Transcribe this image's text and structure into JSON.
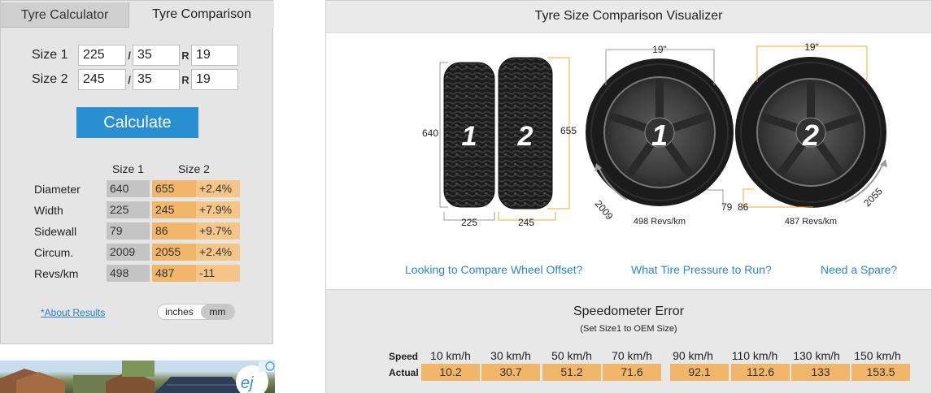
{
  "tabs": {
    "calculator": "Tyre Calculator",
    "comparison": "Tyre Comparison"
  },
  "form": {
    "size1": {
      "label": "Size 1",
      "width": "225",
      "aspect": "35",
      "rim": "19"
    },
    "size2": {
      "label": "Size 2",
      "width": "245",
      "aspect": "35",
      "rim": "19"
    },
    "sep": "/",
    "r": "R",
    "calculate_label": "Calculate"
  },
  "results": {
    "headers": [
      "Size 1",
      "Size 2"
    ],
    "rows": [
      {
        "label": "Diameter",
        "s1": "640",
        "s2": "655",
        "diff": "+2.4%"
      },
      {
        "label": "Width",
        "s1": "225",
        "s2": "245",
        "diff": "+7.9%"
      },
      {
        "label": "Sidewall",
        "s1": "79",
        "s2": "86",
        "diff": "+9.7%"
      },
      {
        "label": "Circum.",
        "s1": "2009",
        "s2": "2055",
        "diff": "+2.4%"
      },
      {
        "label": "Revs/km",
        "s1": "498",
        "s2": "487",
        "diff": "-11"
      }
    ]
  },
  "about_link": "*About Results",
  "units": {
    "inches": "inches",
    "mm": "mm",
    "selected": "mm"
  },
  "visualizer": {
    "title": "Tyre Size Comparison Visualizer",
    "tyre1_number": "1",
    "tyre2_number": "2",
    "diameter1": "640",
    "diameter2": "655",
    "width1": "225",
    "width2": "245",
    "rim1": "19\"",
    "rim2": "19\"",
    "sidewall1": "79",
    "sidewall2": "86",
    "circum1": "2009",
    "circum2": "2055",
    "revs1": "498 Revs/km",
    "revs2": "487 Revs/km",
    "colors": {
      "size1": "#9a9a9a",
      "size2": "#f0a830"
    }
  },
  "links": {
    "offset": "Looking to Compare Wheel Offset?",
    "pressure": "What Tire Pressure to Run?",
    "spare": "Need a Spare?"
  },
  "speedo": {
    "title": "Speedometer Error",
    "subtitle": "(Set Size1 to OEM Size)",
    "speed_label": "Speed",
    "actual_label": "Actual",
    "columns": [
      {
        "speed": "10 km/h",
        "actual": "10.2"
      },
      {
        "speed": "30 km/h",
        "actual": "30.7"
      },
      {
        "speed": "50 km/h",
        "actual": "51.2"
      },
      {
        "speed": "70 km/h",
        "actual": "71.6"
      },
      {
        "speed": "90 km/h",
        "actual": "92.1"
      },
      {
        "speed": "110 km/h",
        "actual": "112.6"
      },
      {
        "speed": "130 km/h",
        "actual": "133"
      },
      {
        "speed": "150 km/h",
        "actual": "153.5"
      }
    ]
  }
}
